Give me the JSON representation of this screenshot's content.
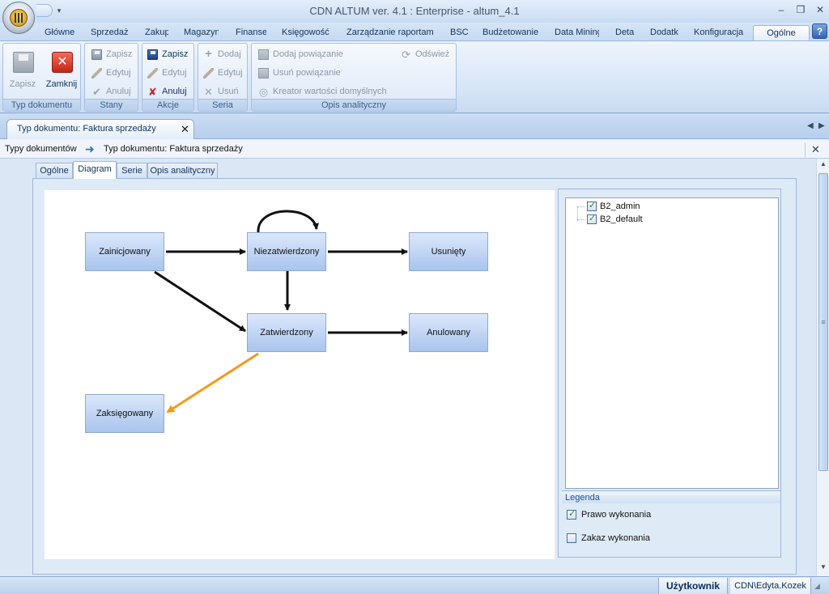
{
  "window": {
    "title": "CDN ALTUM ver. 4.1 : Enterprise - altum_4.1",
    "minimize": "–",
    "restore": "❐",
    "close": "✕"
  },
  "ribbon_tabs": [
    {
      "label": "Główne"
    },
    {
      "label": "Sprzedaż"
    },
    {
      "label": "Zakup"
    },
    {
      "label": "Magazyn"
    },
    {
      "label": "Finanse"
    },
    {
      "label": "Księgowość"
    },
    {
      "label": "Zarządzanie raportami"
    },
    {
      "label": "BSC"
    },
    {
      "label": "Budżetowanie"
    },
    {
      "label": "Data Mining"
    },
    {
      "label": "Detal"
    },
    {
      "label": "Dodatki"
    },
    {
      "label": "Konfiguracja"
    },
    {
      "label": "Ogólne"
    }
  ],
  "help_label": "?",
  "ribbon": {
    "typ_dokumentu": {
      "label": "Typ dokumentu",
      "save": "Zapisz",
      "close": "Zamknij"
    },
    "stany": {
      "label": "Stany",
      "save": "Zapisz",
      "edit": "Edytuj",
      "cancel": "Anuluj"
    },
    "akcje": {
      "label": "Akcje",
      "save": "Zapisz",
      "edit": "Edytuj",
      "cancel": "Anuluj"
    },
    "seria": {
      "label": "Seria",
      "add": "Dodaj",
      "edit": "Edytuj",
      "remove": "Usuń"
    },
    "opis": {
      "label": "Opis analityczny",
      "add_link": "Dodaj powiązanie",
      "remove_link": "Usuń powiązanie",
      "wizard": "Kreator wartości domyślnych",
      "refresh": "Odśwież"
    }
  },
  "document_tab": {
    "label": "Typ dokumentu: Faktura sprzedaży",
    "close": "✕"
  },
  "breadcrumb": {
    "root": "Typy dokumentów",
    "current": "Typ dokumentu: Faktura sprzedaży",
    "close": "✕"
  },
  "content_tabs": [
    {
      "label": "Ogólne"
    },
    {
      "label": "Diagram"
    },
    {
      "label": "Serie"
    },
    {
      "label": "Opis analityczny"
    }
  ],
  "diagram": {
    "nodes": {
      "zainicjowany": "Zainicjowany",
      "niezatwierdzony": "Niezatwierdzony",
      "usuniety": "Usunięty",
      "zatwierdzony": "Zatwierdzony",
      "anulowany": "Anulowany",
      "zaksiegowany": "Zaksięgowany"
    },
    "arrow_color": "#111111",
    "highlight_arrow_color": "#f39a1b"
  },
  "users": [
    {
      "name": "B2_admin",
      "checked": true
    },
    {
      "name": "B2_default",
      "checked": true
    }
  ],
  "legend": {
    "title": "Legenda",
    "allowed": "Prawo wykonania",
    "denied": "Zakaz wykonania"
  },
  "status": {
    "user_label": "Użytkownik",
    "user_value": "CDN\\Edyta.Kozek"
  }
}
